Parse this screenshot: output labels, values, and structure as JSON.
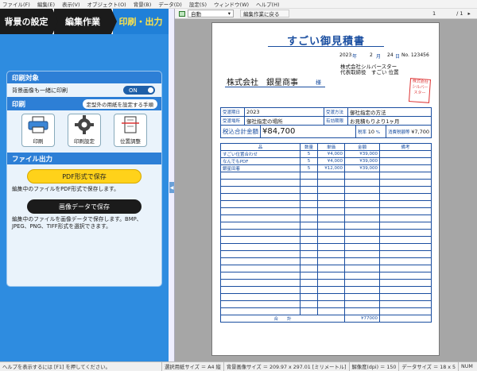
{
  "menu": [
    "ファイル(F)",
    "編集(E)",
    "表示(V)",
    "オブジェクト(O)",
    "背景(B)",
    "データ(D)",
    "設定(S)",
    "ウィンドウ(W)",
    "ヘルプ(H)"
  ],
  "steps": [
    "背景の設定",
    "編集作業",
    "印刷・出力"
  ],
  "print_target": {
    "header": "印刷対象",
    "option_label": "背景画像も一緒に印刷",
    "toggle": "ON"
  },
  "print": {
    "header": "印刷",
    "hint": "定型外の用紙を設定する手順",
    "buttons": [
      "印刷",
      "印刷設定",
      "位置調整"
    ]
  },
  "file_output": {
    "header": "ファイル出力",
    "pdf_button": "PDF形式で保存",
    "pdf_desc": "編集中のファイルをPDF形式で保存します。",
    "image_button": "画像データで保存",
    "image_desc": "編集中のファイルを画像データで保存します。BMP、JPEG、PNG、TIFF形式を選択できます。"
  },
  "toolbar": {
    "zoom": "自動",
    "back": "編集作業に戻る",
    "page_current": "1",
    "page_total": "/ 1"
  },
  "doc": {
    "title": "すごい御見積書",
    "customer": "株式会社　銀星商事",
    "honorific": "様",
    "issuer": "株式会社シルバースター",
    "rep": "代表取締役　すごい 位置",
    "seal": "株式会社シルバースター",
    "year": "2023",
    "month": "2",
    "day": "24",
    "no": "No. 123456",
    "total_label": "税込合計金額",
    "total_value": "¥84,700",
    "tax_rate": "10",
    "tax_value": "¥7,700",
    "place": "御社指定の場所",
    "payment": "お見積もりより1ヶ月",
    "method": "御社指定の方法",
    "col_headers": [
      "品",
      "数量",
      "単価",
      "金額",
      "備考"
    ],
    "items": [
      {
        "name": "すごい位置合わせ",
        "qty": "5",
        "price": "¥4,000",
        "amount": "¥39,000"
      },
      {
        "name": "なんでもPDF",
        "qty": "5",
        "price": "¥4,000",
        "amount": "¥39,000"
      },
      {
        "name": "銀星田着",
        "qty": "5",
        "price": "¥12,000",
        "amount": "¥39,000"
      }
    ],
    "sum_label": "合　　計",
    "sum_value": "¥77000"
  },
  "status": {
    "help": "ヘルプを表示するには [F1] を押してください。",
    "paper": "選択用紙サイズ ＝ A4 縦",
    "bg": "背景画像サイズ ＝ 209.97 x 297.01 [ミリメートル]",
    "dpi": "解像度(dpi) ＝ 150",
    "datasize": "データサイズ ＝ 18 x 5",
    "num": "NUM"
  }
}
